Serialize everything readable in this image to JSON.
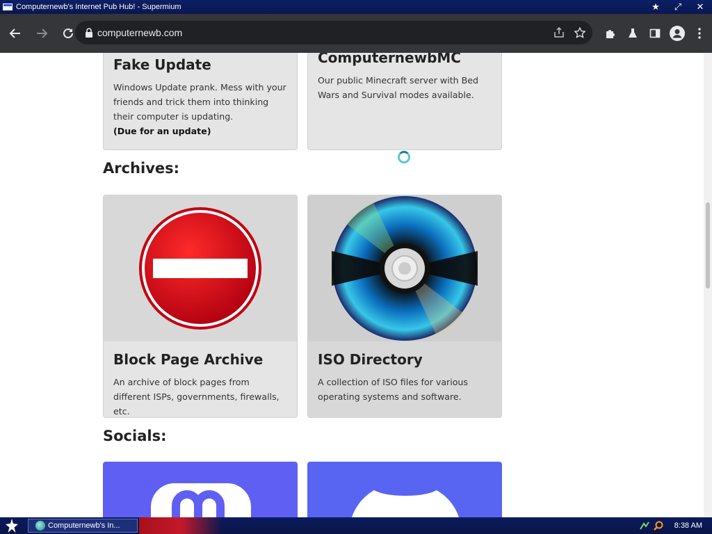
{
  "window": {
    "title": "Computernewb's Internet Pub Hub! - Supermium"
  },
  "browser": {
    "url": "computernewb.com"
  },
  "cards_top": [
    {
      "title": "Fake Update",
      "desc": "Windows Update prank. Mess with your friends and trick them into thinking their computer is updating.",
      "note": "(Due for an update)"
    },
    {
      "title": "ComputernewbMC",
      "desc": "Our public Minecraft server with Bed Wars and Survival modes available."
    }
  ],
  "sections": {
    "archives": "Archives:",
    "socials": "Socials:"
  },
  "archives": [
    {
      "title": "Block Page Archive",
      "desc": "An archive of block pages from different ISPs, governments, firewalls, etc.",
      "icon": "no-entry-icon"
    },
    {
      "title": "ISO Directory",
      "desc": "A collection of ISO files for various operating systems and software.",
      "icon": "cd-disc-icon"
    }
  ],
  "socials": [
    {
      "icon": "mastodon-icon",
      "color": "#5f5ff4"
    },
    {
      "icon": "discord-icon",
      "color": "#5865f2"
    }
  ],
  "taskbar": {
    "task_label": "Computernewb's In...",
    "clock": "8:38 AM"
  },
  "colors": {
    "toolbar": "#35363a",
    "omnibox": "#202124",
    "card": "#e5e5e5",
    "titlebar": "#0c1f66"
  }
}
